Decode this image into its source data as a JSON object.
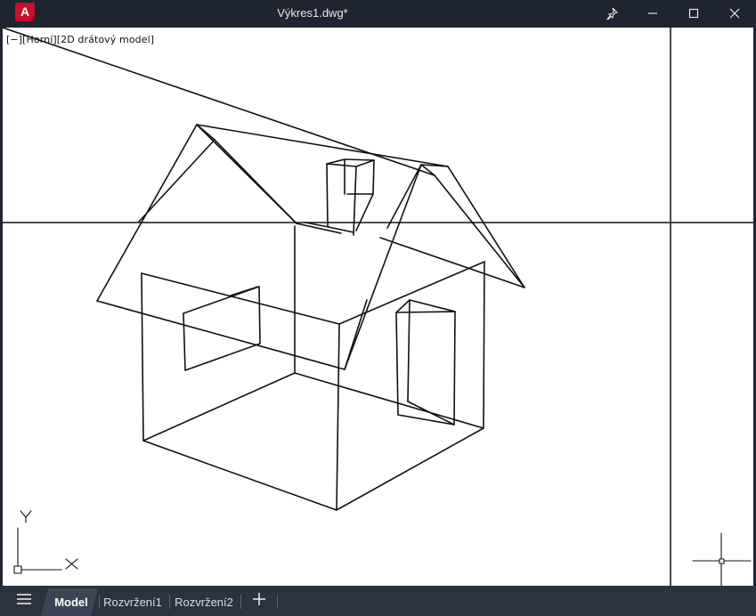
{
  "window": {
    "title": "Výkres1.dwg*",
    "app_logo_letter": "A",
    "brand_color": "#c8102e",
    "titlebar_color": "#1e2531"
  },
  "titlebar_controls": {
    "pin_icon": "pin-icon",
    "minimize_icon": "minimize-icon",
    "maximize_icon": "maximize-icon",
    "close_icon": "close-icon"
  },
  "viewport": {
    "label": "[−][Horní][2D drátový model]",
    "background": "#ffffff",
    "line_color": "#111111"
  },
  "ucs": {
    "x_label": "X",
    "y_label": "Y"
  },
  "tabs": [
    {
      "label": "Model",
      "active": true
    },
    {
      "label": "Rozvržení1",
      "active": false
    },
    {
      "label": "Rozvržení2",
      "active": false
    }
  ],
  "tabbar": {
    "menu_icon": "hamburger-menu-icon",
    "add_icon": "plus-icon"
  }
}
